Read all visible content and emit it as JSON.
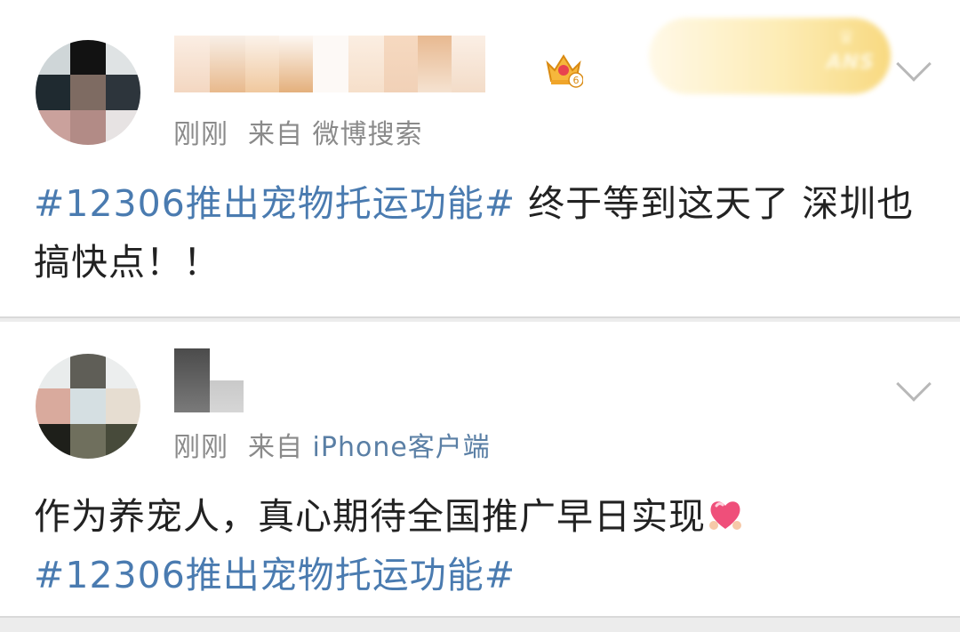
{
  "posts": [
    {
      "meta_time": "刚刚",
      "meta_from": "来自",
      "meta_source": "微博搜索",
      "member_level": "6",
      "fan_badge_text": "ANS",
      "tag": "#12306推出宠物托运功能#",
      "text": " 终于等到这天了 深圳也搞快点！！"
    },
    {
      "meta_time": "刚刚",
      "meta_from": "来自",
      "meta_source": "iPhone客户端",
      "text": "作为养宠人，真心期待全国推广早日实现",
      "emoji": "heart-emoji",
      "tag": "#12306推出宠物托运功能#"
    }
  ],
  "colors": {
    "hashtag": "#4a7bb0",
    "meta": "#8a8a8a",
    "body": "#222222"
  }
}
